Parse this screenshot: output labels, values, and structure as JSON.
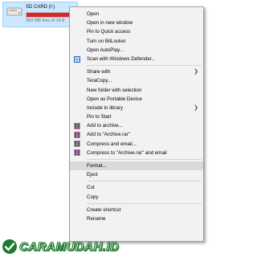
{
  "drive": {
    "name": "SD CARD (I:)",
    "free_text": "360 MB free of 14.8",
    "used_fraction": 0.97,
    "bar_color": "#da2626"
  },
  "menu": {
    "items": [
      {
        "label": "Open",
        "bold": true
      },
      {
        "label": "Open in new window"
      },
      {
        "label": "Pin to Quick access"
      },
      {
        "label": "Turn on BitLocker"
      },
      {
        "label": "Open AutoPlay..."
      },
      {
        "label": "Scan with Windows Defender...",
        "icon": "windows-defender-icon"
      },
      {
        "label": "Share with",
        "submenu": true
      },
      {
        "label": "TeraCopy..."
      },
      {
        "label": "New folder with selection"
      },
      {
        "label": "Open as Portable Device"
      },
      {
        "label": "Include in library",
        "submenu": true
      },
      {
        "label": "Pin to Start"
      },
      {
        "label": "Add to archive...",
        "icon": "winrar-icon"
      },
      {
        "label": "Add to \"Archive.rar\"",
        "icon": "winrar-icon"
      },
      {
        "label": "Compress and email...",
        "icon": "winrar-icon"
      },
      {
        "label": "Compress to \"Archive.rar\" and email",
        "icon": "winrar-icon"
      },
      {
        "label": "Format...",
        "hover": true
      },
      {
        "label": "Eject"
      },
      {
        "label": "Cut"
      },
      {
        "label": "Copy"
      },
      {
        "label": "Create shortcut"
      },
      {
        "label": "Rename"
      }
    ]
  },
  "watermark": {
    "text": "CARAMUDAH.ID",
    "color": "#1d7a2f"
  }
}
